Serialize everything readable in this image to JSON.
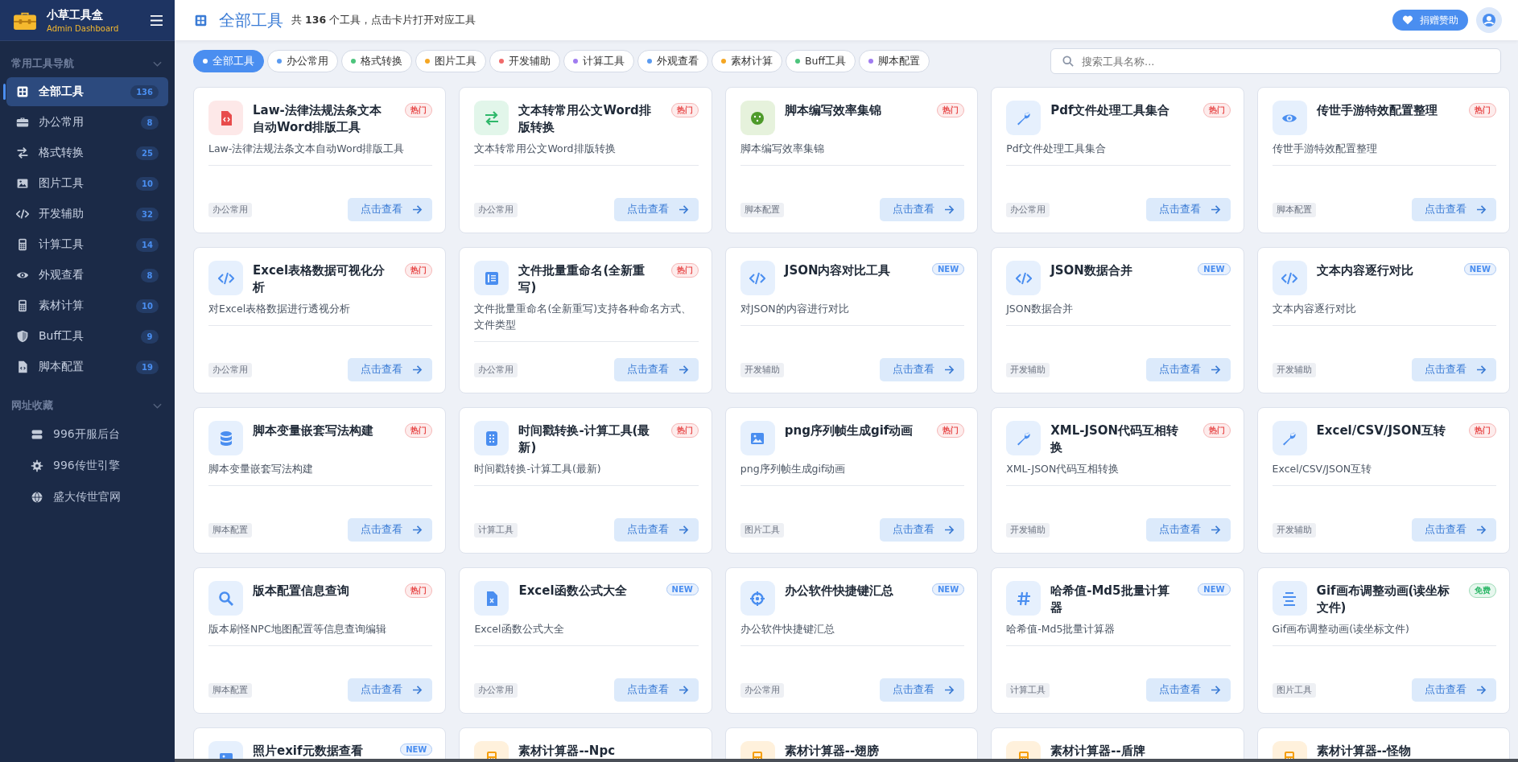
{
  "brand": {
    "name": "小草工具盒",
    "subtitle": "Admin Dashboard"
  },
  "sidebar": {
    "groups": [
      {
        "title": "常用工具导航",
        "expanded": true,
        "items": [
          {
            "label": "全部工具",
            "count": "136",
            "selected": true
          },
          {
            "label": "办公常用",
            "count": "8",
            "selected": false
          },
          {
            "label": "格式转换",
            "count": "25",
            "selected": false
          },
          {
            "label": "图片工具",
            "count": "10",
            "selected": false
          },
          {
            "label": "开发辅助",
            "count": "32",
            "selected": false
          },
          {
            "label": "计算工具",
            "count": "14",
            "selected": false
          },
          {
            "label": "外观查看",
            "count": "8",
            "selected": false
          },
          {
            "label": "素材计算",
            "count": "10",
            "selected": false
          },
          {
            "label": "Buff工具",
            "count": "9",
            "selected": false
          },
          {
            "label": "脚本配置",
            "count": "19",
            "selected": false
          }
        ]
      },
      {
        "title": "网址收藏",
        "expanded": true,
        "items": [
          {
            "label": "996开服后台",
            "selected": false
          },
          {
            "label": "996传世引擎",
            "selected": false
          },
          {
            "label": "盛大传世官网",
            "selected": false
          }
        ]
      }
    ]
  },
  "header": {
    "title": "全部工具",
    "summary": "共 **136** 个工具，点击卡片打开对应工具",
    "donate": "捐赠赞助"
  },
  "filters": [
    {
      "label": "全部工具",
      "color": "#ffffff",
      "selected": true
    },
    {
      "label": "办公常用",
      "color": "#5b9bf0",
      "selected": false
    },
    {
      "label": "格式转换",
      "color": "#4cc47c",
      "selected": false
    },
    {
      "label": "图片工具",
      "color": "#f5a623",
      "selected": false
    },
    {
      "label": "开发辅助",
      "color": "#f06a6a",
      "selected": false
    },
    {
      "label": "计算工具",
      "color": "#a07cf0",
      "selected": false
    },
    {
      "label": "外观查看",
      "color": "#5b9bf0",
      "selected": false
    },
    {
      "label": "素材计算",
      "color": "#f5a623",
      "selected": false
    },
    {
      "label": "Buff工具",
      "color": "#4cc47c",
      "selected": false
    },
    {
      "label": "脚本配置",
      "color": "#a07cf0",
      "selected": false
    }
  ],
  "search": {
    "placeholder": "搜索工具名称..."
  },
  "cards": [
    {
      "title": "Law-法律法规法条文本自动Word排版工具",
      "badge": {
        "kind": "hot",
        "text": "热门"
      },
      "description": "Law-法律法规法条文本自动Word排版工具",
      "tag": "办公常用",
      "action": "点击查看"
    },
    {
      "title": "文本转常用公文Word排版转换",
      "badge": {
        "kind": "hot",
        "text": "热门"
      },
      "description": "文本转常用公文Word排版转换",
      "tag": "办公常用",
      "action": "点击查看"
    },
    {
      "title": "脚本编写效率集锦",
      "badge": {
        "kind": "hot",
        "text": "热门"
      },
      "description": "脚本编写效率集锦",
      "tag": "脚本配置",
      "action": "点击查看"
    },
    {
      "title": "Pdf文件处理工具集合",
      "badge": {
        "kind": "hot",
        "text": "热门"
      },
      "description": "Pdf文件处理工具集合",
      "tag": "办公常用",
      "action": "点击查看"
    },
    {
      "title": "传世手游特效配置整理",
      "badge": {
        "kind": "hot",
        "text": "热门"
      },
      "description": "传世手游特效配置整理",
      "tag": "脚本配置",
      "action": "点击查看"
    },
    {
      "title": "Excel表格数据可视化分析",
      "badge": {
        "kind": "hot",
        "text": "热门"
      },
      "description": "对Excel表格数据进行透视分析",
      "tag": "办公常用",
      "action": "点击查看"
    },
    {
      "title": "文件批量重命名(全新重写)",
      "badge": {
        "kind": "hot",
        "text": "热门"
      },
      "description": "文件批量重命名(全新重写)支持各种命名方式、文件类型",
      "tag": "办公常用",
      "action": "点击查看"
    },
    {
      "title": "JSON内容对比工具",
      "badge": {
        "kind": "new",
        "text": "NEW"
      },
      "description": "对JSON的内容进行对比",
      "tag": "开发辅助",
      "action": "点击查看"
    },
    {
      "title": "JSON数据合并",
      "badge": {
        "kind": "new",
        "text": "NEW"
      },
      "description": "JSON数据合并",
      "tag": "开发辅助",
      "action": "点击查看"
    },
    {
      "title": "文本内容逐行对比",
      "badge": {
        "kind": "new",
        "text": "NEW"
      },
      "description": "文本内容逐行对比",
      "tag": "开发辅助",
      "action": "点击查看"
    },
    {
      "title": "脚本变量嵌套写法构建",
      "badge": {
        "kind": "hot",
        "text": "热门"
      },
      "description": "脚本变量嵌套写法构建",
      "tag": "脚本配置",
      "action": "点击查看"
    },
    {
      "title": "时间戳转换-计算工具(最新)",
      "badge": {
        "kind": "hot",
        "text": "热门"
      },
      "description": "时间戳转换-计算工具(最新)",
      "tag": "计算工具",
      "action": "点击查看"
    },
    {
      "title": "png序列帧生成gif动画",
      "badge": {
        "kind": "hot",
        "text": "热门"
      },
      "description": "png序列帧生成gif动画",
      "tag": "图片工具",
      "action": "点击查看"
    },
    {
      "title": "XML-JSON代码互相转换",
      "badge": {
        "kind": "hot",
        "text": "热门"
      },
      "description": "XML-JSON代码互相转换",
      "tag": "开发辅助",
      "action": "点击查看"
    },
    {
      "title": "Excel/CSV/JSON互转",
      "badge": {
        "kind": "hot",
        "text": "热门"
      },
      "description": "Excel/CSV/JSON互转",
      "tag": "开发辅助",
      "action": "点击查看"
    },
    {
      "title": "版本配置信息查询",
      "badge": {
        "kind": "hot",
        "text": "热门"
      },
      "description": "版本刷怪NPC地图配置等信息查询编辑",
      "tag": "脚本配置",
      "action": "点击查看"
    },
    {
      "title": "Excel函数公式大全",
      "badge": {
        "kind": "new",
        "text": "NEW"
      },
      "description": "Excel函数公式大全",
      "tag": "办公常用",
      "action": "点击查看"
    },
    {
      "title": "办公软件快捷键汇总",
      "badge": {
        "kind": "new",
        "text": "NEW"
      },
      "description": "办公软件快捷键汇总",
      "tag": "办公常用",
      "action": "点击查看"
    },
    {
      "title": "哈希值-Md5批量计算器",
      "badge": {
        "kind": "new",
        "text": "NEW"
      },
      "description": "哈希值-Md5批量计算器",
      "tag": "计算工具",
      "action": "点击查看"
    },
    {
      "title": "Gif画布调整动画(读坐标文件)",
      "badge": {
        "kind": "free",
        "text": "免费"
      },
      "description": "Gif画布调整动画(读坐标文件)",
      "tag": "图片工具",
      "action": "点击查看"
    },
    {
      "title": "照片exif元数据查看",
      "badge": {
        "kind": "new",
        "text": "NEW"
      }
    },
    {
      "title": "素材计算器--Npc"
    },
    {
      "title": "素材计算器--翅膀"
    },
    {
      "title": "素材计算器--盾牌"
    },
    {
      "title": "素材计算器--怪物"
    }
  ]
}
